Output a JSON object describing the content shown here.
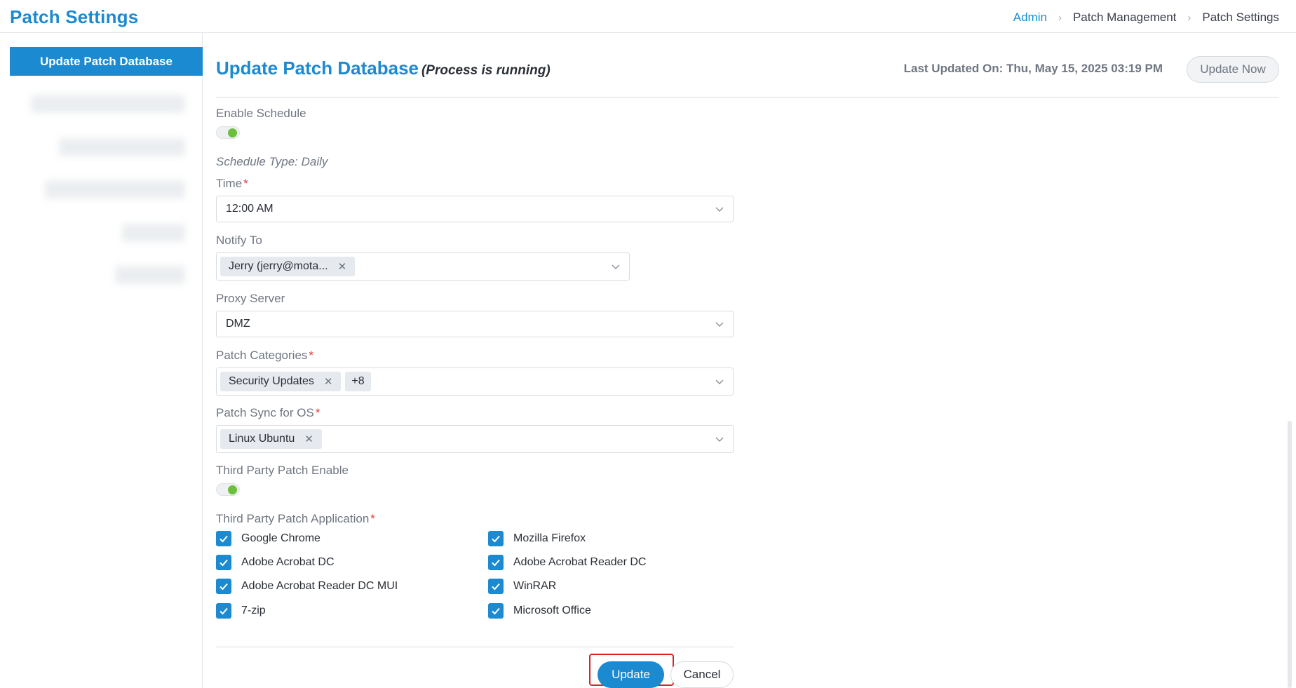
{
  "header": {
    "title": "Patch Settings",
    "breadcrumb": [
      "Admin",
      "Patch Management",
      "Patch Settings"
    ]
  },
  "sidebar": {
    "active_item": "Update Patch Database"
  },
  "main": {
    "title": "Update Patch Database",
    "subtitle": "(Process is running)",
    "last_updated": "Last Updated On: Thu, May 15, 2025 03:19 PM",
    "update_now_label": "Update Now"
  },
  "form": {
    "enable_schedule_label": "Enable Schedule",
    "enable_schedule_on": true,
    "schedule_type": "Schedule Type: Daily",
    "time_label": "Time",
    "time_value": "12:00 AM",
    "notify_to_label": "Notify To",
    "notify_to_tag": "Jerry (jerry@mota...",
    "proxy_server_label": "Proxy Server",
    "proxy_server_value": "DMZ",
    "patch_categories_label": "Patch Categories",
    "patch_categories_tag": "Security Updates",
    "patch_categories_more": "+8",
    "patch_sync_os_label": "Patch Sync for OS",
    "patch_sync_os_tag": "Linux Ubuntu",
    "third_party_enable_label": "Third Party Patch Enable",
    "third_party_enable_on": true,
    "third_party_app_label": "Third Party Patch Application",
    "apps": [
      {
        "label": "Google Chrome",
        "checked": true
      },
      {
        "label": "Mozilla Firefox",
        "checked": true
      },
      {
        "label": "Adobe Acrobat DC",
        "checked": true
      },
      {
        "label": "Adobe Acrobat Reader DC",
        "checked": true
      },
      {
        "label": "Adobe Acrobat Reader DC MUI",
        "checked": true
      },
      {
        "label": "WinRAR",
        "checked": true
      },
      {
        "label": "7-zip",
        "checked": true
      },
      {
        "label": "Microsoft Office",
        "checked": true
      }
    ]
  },
  "actions": {
    "update_label": "Update",
    "cancel_label": "Cancel"
  },
  "colors": {
    "accent": "#1c8ad0",
    "toggle_on": "#6cbf3c",
    "required": "#e23b3b",
    "highlight_border": "#d92228"
  }
}
